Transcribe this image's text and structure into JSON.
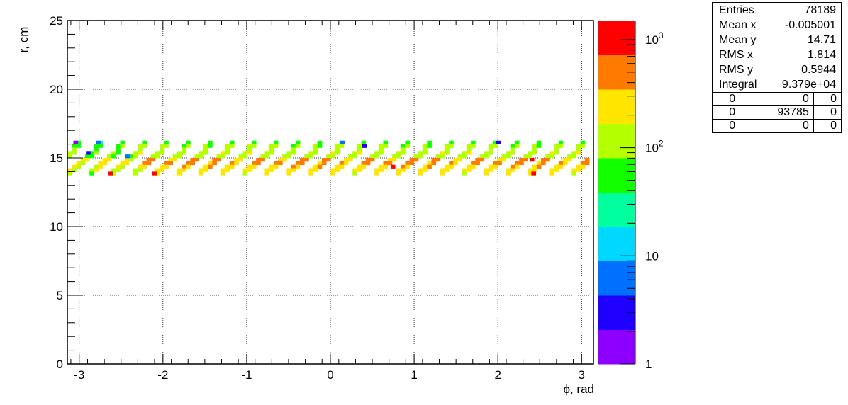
{
  "chart_data": {
    "type": "heatmap",
    "xlabel": "ϕ, rad",
    "ylabel": "r, cm",
    "xlim": [
      -3.1416,
      3.1416
    ],
    "ylim": [
      0,
      25
    ],
    "x_ticks": [
      "-3",
      "-2",
      "-1",
      "0",
      "1",
      "2",
      "3"
    ],
    "x_tick_values": [
      -3,
      -2,
      -1,
      0,
      1,
      2,
      3
    ],
    "y_ticks": [
      "0",
      "5",
      "10",
      "15",
      "20",
      "25"
    ],
    "y_tick_values": [
      0,
      5,
      10,
      15,
      20,
      25
    ],
    "grid": true,
    "z_scale": "log",
    "z_range": [
      1,
      1500
    ],
    "z_ticks": [
      {
        "label": "1",
        "value": 1,
        "exp": ""
      },
      {
        "label": "10",
        "value": 10,
        "exp": ""
      },
      {
        "label": "10",
        "value": 100,
        "exp": "2"
      },
      {
        "label": "10",
        "value": 1000,
        "exp": "3"
      }
    ],
    "colorscale": [
      "#8d00ff",
      "#1f00ff",
      "#0070ff",
      "#00d8ff",
      "#00ff9e",
      "#12ff00",
      "#b4ff00",
      "#ffe600",
      "#ff7a00",
      "#ff0000"
    ],
    "pattern": {
      "phi_period": 0.2618,
      "phi_bin_width": 0.0524,
      "r_bin_height": 0.25,
      "rows": [
        {
          "r": 16.0,
          "offsets": [
            3
          ],
          "value": 60
        },
        {
          "r": 15.75,
          "offsets": [
            2,
            3
          ],
          "value": 100
        },
        {
          "r": 15.5,
          "offsets": [
            2
          ],
          "value": 120
        },
        {
          "r": 15.25,
          "offsets": [
            1,
            2
          ],
          "value": 150
        },
        {
          "r": 15.0,
          "offsets": [
            0,
            1
          ],
          "value": 120
        },
        {
          "r": 14.75,
          "offsets": [
            0,
            4
          ],
          "value": 350
        },
        {
          "r": 14.5,
          "offsets": [
            3,
            4
          ],
          "value": 400
        },
        {
          "r": 14.25,
          "offsets": [
            2,
            3
          ],
          "value": 300
        },
        {
          "r": 14.0,
          "offsets": [
            1,
            2
          ],
          "value": 220
        },
        {
          "r": 13.75,
          "offsets": [
            1
          ],
          "value": 200
        }
      ]
    },
    "hot_cells": [
      {
        "phi": -2.65,
        "r": 13.75,
        "value": 1400
      },
      {
        "phi": -2.13,
        "r": 13.75,
        "value": 1300
      },
      {
        "phi": 0.72,
        "r": 14.25,
        "value": 1000
      },
      {
        "phi": 2.38,
        "r": 14.75,
        "value": 800
      },
      {
        "phi": 2.4,
        "r": 13.75,
        "value": 900
      },
      {
        "phi": -2.92,
        "r": 15.25,
        "value": 3
      },
      {
        "phi": -2.8,
        "r": 16.0,
        "value": 5
      },
      {
        "phi": 0.12,
        "r": 16.0,
        "value": 6
      },
      {
        "phi": 0.38,
        "r": 15.75,
        "value": 3
      },
      {
        "phi": 1.98,
        "r": 16.0,
        "value": 3
      },
      {
        "phi": -3.07,
        "r": 16.0,
        "value": 2
      },
      {
        "phi": -2.45,
        "r": 15.0,
        "value": 8
      }
    ]
  },
  "stats": {
    "rows": [
      {
        "label": "Entries",
        "value": "78189"
      },
      {
        "label": "Mean x",
        "value": "-0.005001"
      },
      {
        "label": "Mean y",
        "value": "14.71"
      },
      {
        "label": "RMS x",
        "value": "1.814"
      },
      {
        "label": "RMS y",
        "value": "0.5944"
      },
      {
        "label": "Integral",
        "value": "9.379e+04"
      }
    ],
    "grid": [
      [
        "0",
        "0",
        "0"
      ],
      [
        "0",
        "93785",
        "0"
      ],
      [
        "0",
        "0",
        "0"
      ]
    ]
  }
}
